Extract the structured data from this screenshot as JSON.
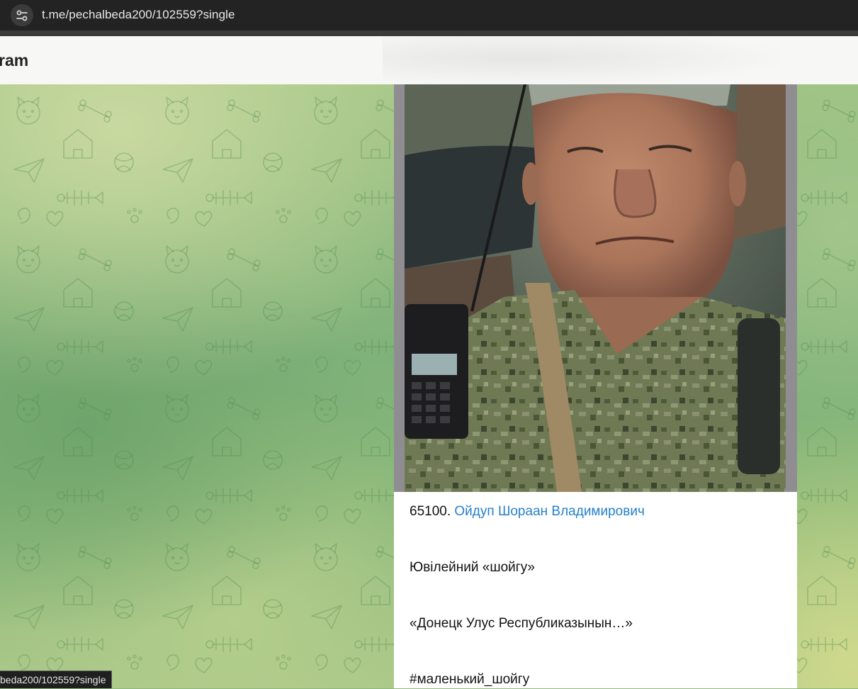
{
  "browser": {
    "url": "t.me/pechalbeda200/102559?single",
    "site_info_icon": "tune-icon",
    "status_url": "beda200/102559?single"
  },
  "header": {
    "title": "ram"
  },
  "message": {
    "photo_icon": "soldier-selfie-photo",
    "number": "65100.",
    "name_link": "Ойдуп Шораан Владимирович",
    "line2": "Ювілейний «шойгу»",
    "line3": "«Донецк Улус Республиказынын…»",
    "hashtag": "#маленький_шойгу"
  },
  "colors": {
    "link": "#2481cc",
    "header_bg": "#f7f7f5",
    "address_bar_bg": "#232323"
  }
}
